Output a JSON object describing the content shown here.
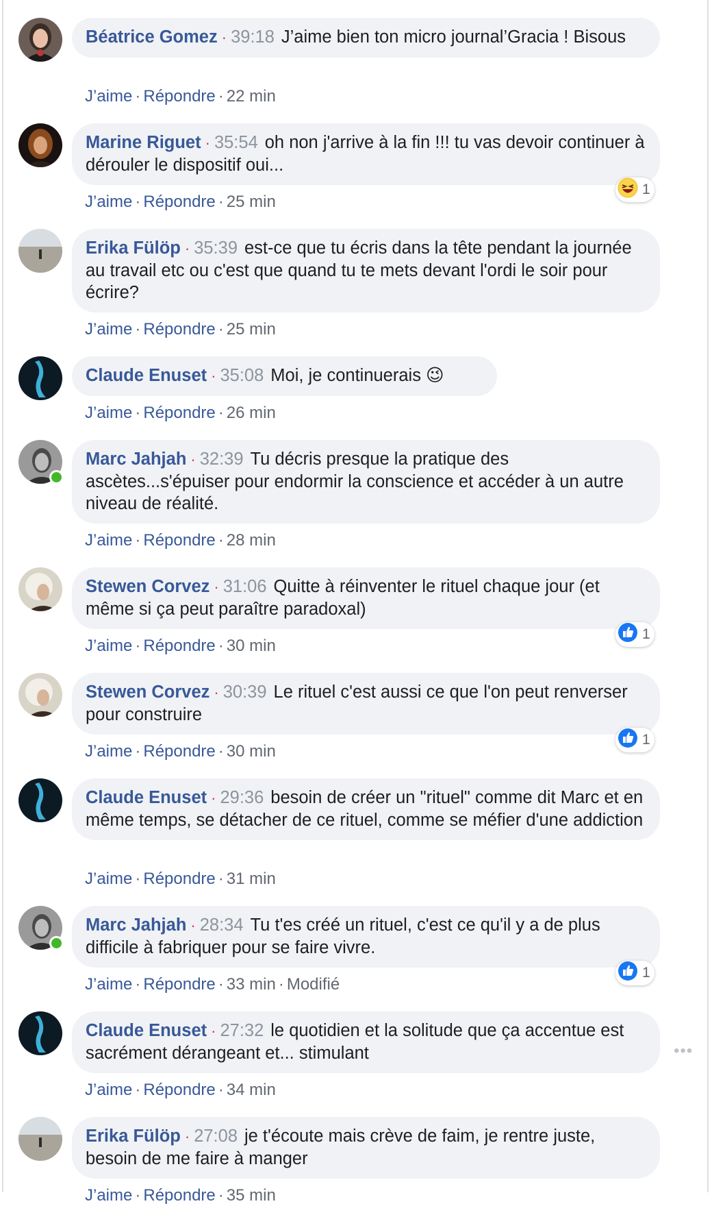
{
  "actions": {
    "like": "J’aime",
    "reply": "Répondre",
    "separator": "·",
    "edited": "Modifié"
  },
  "comments": [
    {
      "author": "Béatrice Gomez",
      "timestamp": "39:18",
      "text": "J’aime bien ton micro journal’Gracia ! Bisous",
      "age": "22 min"
    },
    {
      "author": "Marine Riguet",
      "timestamp": "35:54",
      "text": "oh non j'arrive à la fin !!! tu vas devoir continuer à dérouler le dispositif oui...",
      "age": "25 min",
      "reaction": {
        "icon": "laughing-emoji-icon",
        "count": "1"
      }
    },
    {
      "author": "Erika Fülöp",
      "timestamp": "35:39",
      "text": "est-ce que tu écris dans la tête pendant la journée au travail etc ou c'est que quand tu te mets devant l'ordi le soir pour écrire?",
      "age": "25 min"
    },
    {
      "author": "Claude Enuset",
      "timestamp": "35:08",
      "text": "Moi, je continuerais 😉",
      "age": "26 min"
    },
    {
      "author": "Marc Jahjah",
      "timestamp": "32:39",
      "text": "Tu décris presque la pratique des ascètes...s'épuiser pour endormir la conscience et accéder à un autre niveau de réalité.",
      "age": "28 min",
      "online": true
    },
    {
      "author": "Stewen Corvez",
      "timestamp": "31:06",
      "text": "Quitte à réinventer le rituel chaque jour (et même si ça peut paraître paradoxal)",
      "age": "30 min",
      "reaction": {
        "icon": "thumbs-up-icon",
        "count": "1"
      }
    },
    {
      "author": "Stewen Corvez",
      "timestamp": "30:39",
      "text": "Le rituel c'est aussi ce que l'on peut renverser pour construire",
      "age": "30 min",
      "reaction": {
        "icon": "thumbs-up-icon",
        "count": "1"
      }
    },
    {
      "author": "Claude Enuset",
      "timestamp": "29:36",
      "text": "besoin de créer un \"rituel\" comme dit Marc et en même temps, se détacher de ce rituel, comme se méfier d'une addiction",
      "age": "31 min"
    },
    {
      "author": "Marc Jahjah",
      "timestamp": "28:34",
      "text": "Tu t'es créé un rituel, c'est ce qu'il y a de plus difficile à fabriquer pour se faire vivre.",
      "age": "33 min",
      "edited": true,
      "online": true,
      "reaction": {
        "icon": "thumbs-up-icon",
        "count": "1"
      }
    },
    {
      "author": "Claude Enuset",
      "timestamp": "27:32",
      "text": "le quotidien et la solitude que ça accentue est sacrément dérangeant et... stimulant",
      "age": "34 min",
      "more_options": "•••"
    },
    {
      "author": "Erika Fülöp",
      "timestamp": "27:08",
      "text": "je t'écoute mais crève de faim, je rentre juste, besoin de me faire à manger",
      "age": "35 min"
    }
  ],
  "colors": {
    "author": "#385898",
    "link": "#385898",
    "bubble": "#f0f2f5",
    "online": "#42b72a",
    "like_blue": "#1877f2",
    "timestamp_dot": "#e0245e"
  }
}
